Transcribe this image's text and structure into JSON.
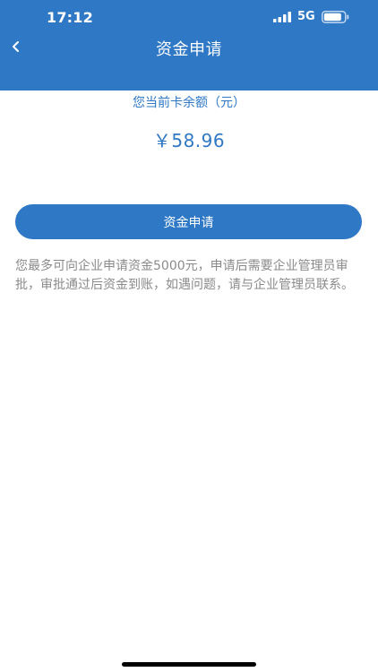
{
  "status_bar": {
    "time": "17:12",
    "network": "5G",
    "signal_icon": "cellular-signal-icon",
    "battery_icon": "battery-icon"
  },
  "nav": {
    "back_icon": "chevron-left-icon",
    "title": "资金申请"
  },
  "balance": {
    "label": "您当前卡余额（元）",
    "amount": "￥58.96"
  },
  "apply_button": {
    "label": "资金申请"
  },
  "notice": {
    "text": "您最多可向企业申请资金5000元，申请后需要企业管理员审批，审批通过后资金到账，如遇问题，请与企业管理员联系。"
  },
  "colors": {
    "accent": "#2f78c5",
    "notice_text": "#8a8a8a",
    "background": "#ffffff"
  }
}
